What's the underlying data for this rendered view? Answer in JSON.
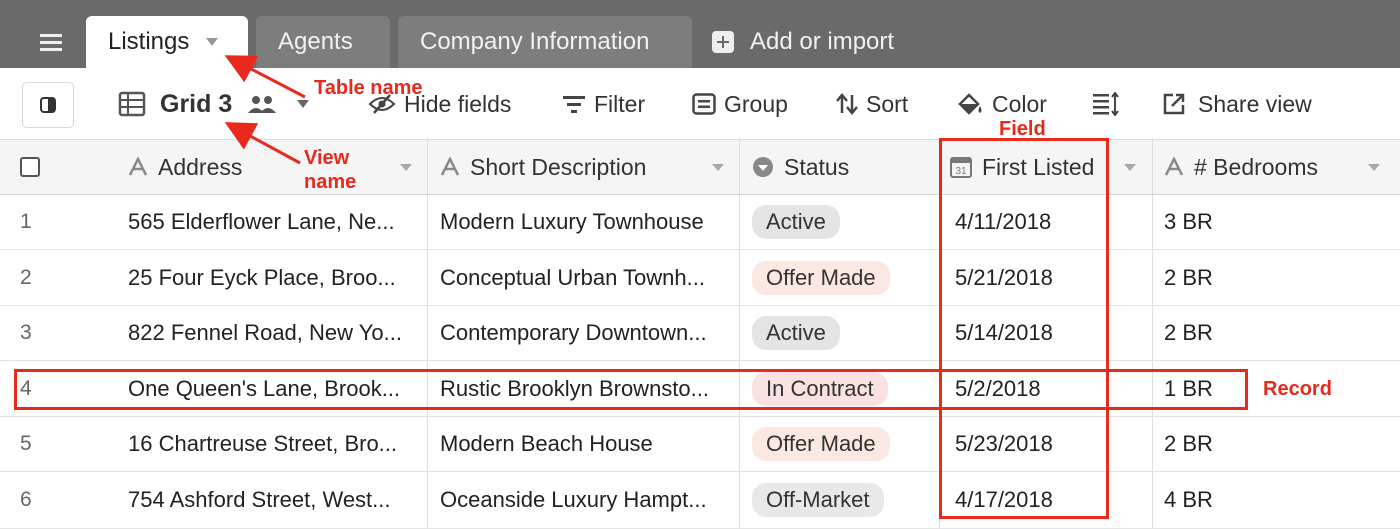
{
  "tabs": [
    {
      "label": "Listings"
    },
    {
      "label": "Agents"
    },
    {
      "label": "Company Information"
    }
  ],
  "add_import_label": "Add or import",
  "toolbar": {
    "view_name": "Grid 3",
    "hide_fields": "Hide fields",
    "filter": "Filter",
    "group": "Group",
    "sort": "Sort",
    "color": "Color",
    "share_view": "Share view"
  },
  "columns": [
    {
      "label": "Address",
      "icon": "text-field-icon"
    },
    {
      "label": "Short Description",
      "icon": "text-field-icon"
    },
    {
      "label": "Status",
      "icon": "single-select-icon"
    },
    {
      "label": "First Listed",
      "icon": "calendar-icon"
    },
    {
      "label": "# Bedrooms",
      "icon": "text-field-icon"
    }
  ],
  "rows": [
    {
      "num": "1",
      "address": "565 Elderflower Lane, Ne...",
      "description": "Modern Luxury Townhouse",
      "status": "Active",
      "date": "4/11/2018",
      "bedrooms": "3 BR"
    },
    {
      "num": "2",
      "address": "25 Four Eyck Place, Broo...",
      "description": "Conceptual Urban Townh...",
      "status": "Offer Made",
      "date": "5/21/2018",
      "bedrooms": "2 BR"
    },
    {
      "num": "3",
      "address": "822 Fennel Road, New Yo...",
      "description": "Contemporary Downtown...",
      "status": "Active",
      "date": "5/14/2018",
      "bedrooms": "2 BR"
    },
    {
      "num": "4",
      "address": "One Queen's Lane, Brook...",
      "description": "Rustic Brooklyn Brownsto...",
      "status": "In Contract",
      "date": "5/2/2018",
      "bedrooms": "1 BR"
    },
    {
      "num": "5",
      "address": "16 Chartreuse Street, Bro...",
      "description": "Modern Beach House",
      "status": "Offer Made",
      "date": "5/23/2018",
      "bedrooms": "2 BR"
    },
    {
      "num": "6",
      "address": "754 Ashford Street, West...",
      "description": "Oceanside Luxury Hampt...",
      "status": "Off-Market",
      "date": "4/17/2018",
      "bedrooms": "4 BR"
    }
  ],
  "status_colors": {
    "Active": "#e4e4e4",
    "Offer Made": "#fbe8e2",
    "In Contract": "#fbe2e2",
    "Off-Market": "#e8e8e8"
  },
  "annotations": {
    "table_name": "Table name",
    "view_name": "View name",
    "field": "Field",
    "record": "Record",
    "color": "#e8291b"
  }
}
